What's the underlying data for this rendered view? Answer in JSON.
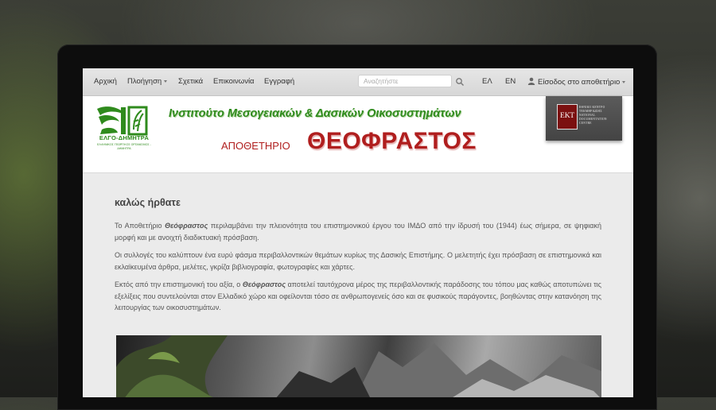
{
  "navbar": {
    "items": [
      {
        "label": "Αρχική"
      },
      {
        "label": "Πλοήγηση"
      },
      {
        "label": "Σχετικά"
      },
      {
        "label": "Επικοινωνία"
      },
      {
        "label": "Εγγραφή"
      }
    ],
    "search_placeholder": "Αναζητήστε",
    "languages": [
      "ΕΛ",
      "EN"
    ],
    "user_menu": "Είσοδος στο αποθετήριο"
  },
  "header": {
    "elgo_name": "ΕΛΓΟ-ΔΗΜΗΤΡΑ",
    "elgo_full": "ΕΛΛΗΝΙΚΟΣ ΓΕΩΡΓΙΚΟΣ ΟΡΓΑΝΙΣΜΟΣ - ΔΗΜΗΤΡΑ",
    "institute": "Ινστιτούτο Μεσογειακών & Δασικών Οικοσυστημάτων",
    "repo_label": "ΑΠΟΘΕΤΗΡΙΟ",
    "repo_name": "ΘΕΟΦΡΑΣΤΟΣ",
    "ekt_logo": "ΕΚΤ",
    "ekt_lines": [
      "ΕΘΝΙΚΟ ΚΕΝΤΡΟ",
      "ΤΕΚΜΗΡΙΩΣΗΣ",
      "NATIONAL",
      "DOCUMENTATION",
      "CENTRE"
    ]
  },
  "main": {
    "welcome": "καλώς ήρθατε",
    "p1_before": "Το Αποθετήριο ",
    "p1_em": "Θεόφραστος",
    "p1_after": " περιλαμβάνει την πλειονότητα του επιστημονικού έργου του ΙΜΔΟ από την ίδρυσή του (1944) έως σήμερα, σε ψηφιακή μορφή και με ανοιχτή διαδικτυακή πρόσβαση.",
    "p2": "Οι συλλογές του καλύπτουν ένα ευρύ φάσμα περιβαλλοντικών θεμάτων κυρίως της Δασικής Επιστήμης. Ο μελετητής έχει πρόσβαση σε επιστημονικά και εκλαϊκευμένα άρθρα, μελέτες, γκρίζα βιβλιογραφία, φωτογραφίες και χάρτες.",
    "p3_before": "Εκτός από την επιστημονική του αξία, ο ",
    "p3_em": "Θεόφραστος",
    "p3_after": " αποτελεί ταυτόχρονα μέρος της περιβαλλοντικής παράδοσης του τόπου μας καθώς αποτυπώνει τις εξελίξεις που συντελούνται στον Ελλαδικό χώρο και οφείλονται τόσο σε ανθρωπογενείς όσο και σε φυσικούς παράγοντες, βοηθώντας στην κατανόηση της λειτουργίας των οικοσυστημάτων."
  },
  "colors": {
    "green": "#2f8b1d",
    "red": "#b01e1e"
  }
}
